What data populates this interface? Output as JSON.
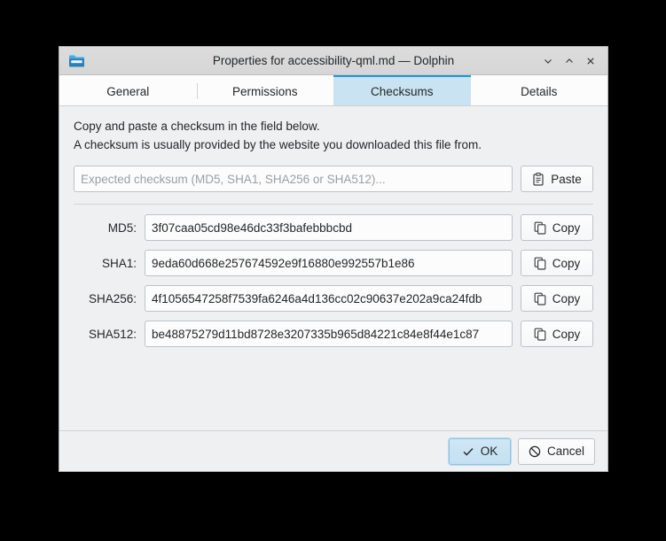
{
  "window": {
    "title": "Properties for accessibility-qml.md — Dolphin",
    "icon": "folder-icon",
    "controls": {
      "minimize": "chevron-down-icon",
      "maximize": "chevron-up-icon",
      "close": "close-icon"
    }
  },
  "tabs": [
    {
      "label": "General",
      "active": false
    },
    {
      "label": "Permissions",
      "active": false
    },
    {
      "label": "Checksums",
      "active": true
    },
    {
      "label": "Details",
      "active": false
    }
  ],
  "content": {
    "intro_line1": "Copy and paste a checksum in the field below.",
    "intro_line2": "A checksum is usually provided by the website you downloaded this file from.",
    "expected": {
      "placeholder": "Expected checksum (MD5, SHA1, SHA256 or SHA512)...",
      "value": "",
      "button_label": "Paste",
      "button_icon": "clipboard-paste-icon"
    },
    "hashes": [
      {
        "label": "MD5:",
        "value": "3f07caa05cd98e46dc33f3bafebbbcbd",
        "button_label": "Copy",
        "button_icon": "copy-icon"
      },
      {
        "label": "SHA1:",
        "value": "9eda60d668e257674592e9f16880e992557b1e86",
        "button_label": "Copy",
        "button_icon": "copy-icon"
      },
      {
        "label": "SHA256:",
        "value": "4f1056547258f7539fa6246a4d136cc02c90637e202a9ca24fdb",
        "button_label": "Copy",
        "button_icon": "copy-icon"
      },
      {
        "label": "SHA512:",
        "value": "be48875279d11bd8728e3207335b965d84221c84e8f44e1c87",
        "button_label": "Copy",
        "button_icon": "copy-icon"
      }
    ]
  },
  "footer": {
    "ok_label": "OK",
    "ok_icon": "check-icon",
    "cancel_label": "Cancel",
    "cancel_icon": "cancel-icon"
  },
  "colors": {
    "accent": "#2196d6",
    "active_tab_bg": "#c9e3f2",
    "dialog_bg": "#eff0f1",
    "text": "#232629",
    "placeholder": "#9a9fa3",
    "desktop": "#000000"
  }
}
